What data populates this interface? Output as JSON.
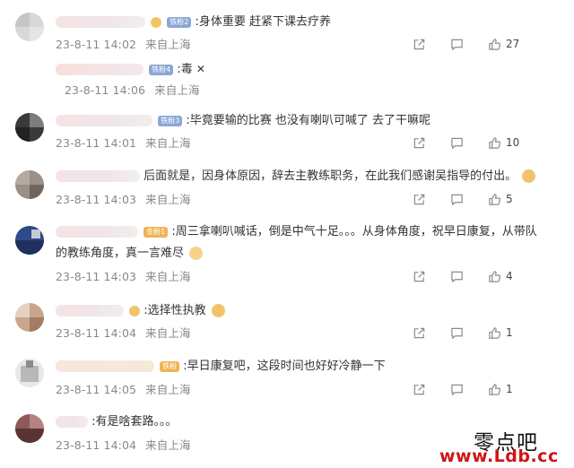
{
  "comments": [
    {
      "text": ":身体重要 赶紧下课去疗养",
      "badge": "铁粉2",
      "date": "23-8-11 14:02",
      "location": "来自上海",
      "likes": "27"
    },
    {
      "text": ":毒",
      "badge": "铁粉4",
      "date": "23-8-11 14:06",
      "location": "来自上海",
      "likes": ""
    },
    {
      "text": ":毕竟要输的比赛 也没有喇叭可喊了 去了干嘛呢",
      "badge": "铁粉3",
      "date": "23-8-11 14:01",
      "location": "来自上海",
      "likes": "10"
    },
    {
      "text": "后面就是，因身体原因，辞去主教练职务，在此我们感谢吴指导的付出。",
      "badge": "",
      "date": "23-8-11 14:03",
      "location": "来自上海",
      "likes": "5"
    },
    {
      "text": ":周三拿喇叭喊话，倒是中气十足。。。从身体角度，祝早日康复，从带队",
      "text_line2": "的教练角度，真一言难尽",
      "badge": "金粉1",
      "date": "23-8-11 14:03",
      "location": "来自上海",
      "likes": "4"
    },
    {
      "text": ":选择性执教",
      "badge": "",
      "date": "23-8-11 14:04",
      "location": "来自上海",
      "likes": "1"
    },
    {
      "text": ":早日康复吧，这段时间也好好冷静一下",
      "badge": "铁粉",
      "date": "23-8-11 14:05",
      "location": "来自上海",
      "likes": "1"
    },
    {
      "text": ":有是啥套路。。。",
      "badge": "",
      "date": "23-8-11 14:04",
      "location": "来自上海",
      "likes": ""
    }
  ],
  "watermark": {
    "brand": "零点吧",
    "url": "www.Ldb.cc",
    "color": "#d01515"
  },
  "icons": {
    "share": "share-icon",
    "comment": "comment-icon",
    "like": "thumbs-up-icon"
  }
}
